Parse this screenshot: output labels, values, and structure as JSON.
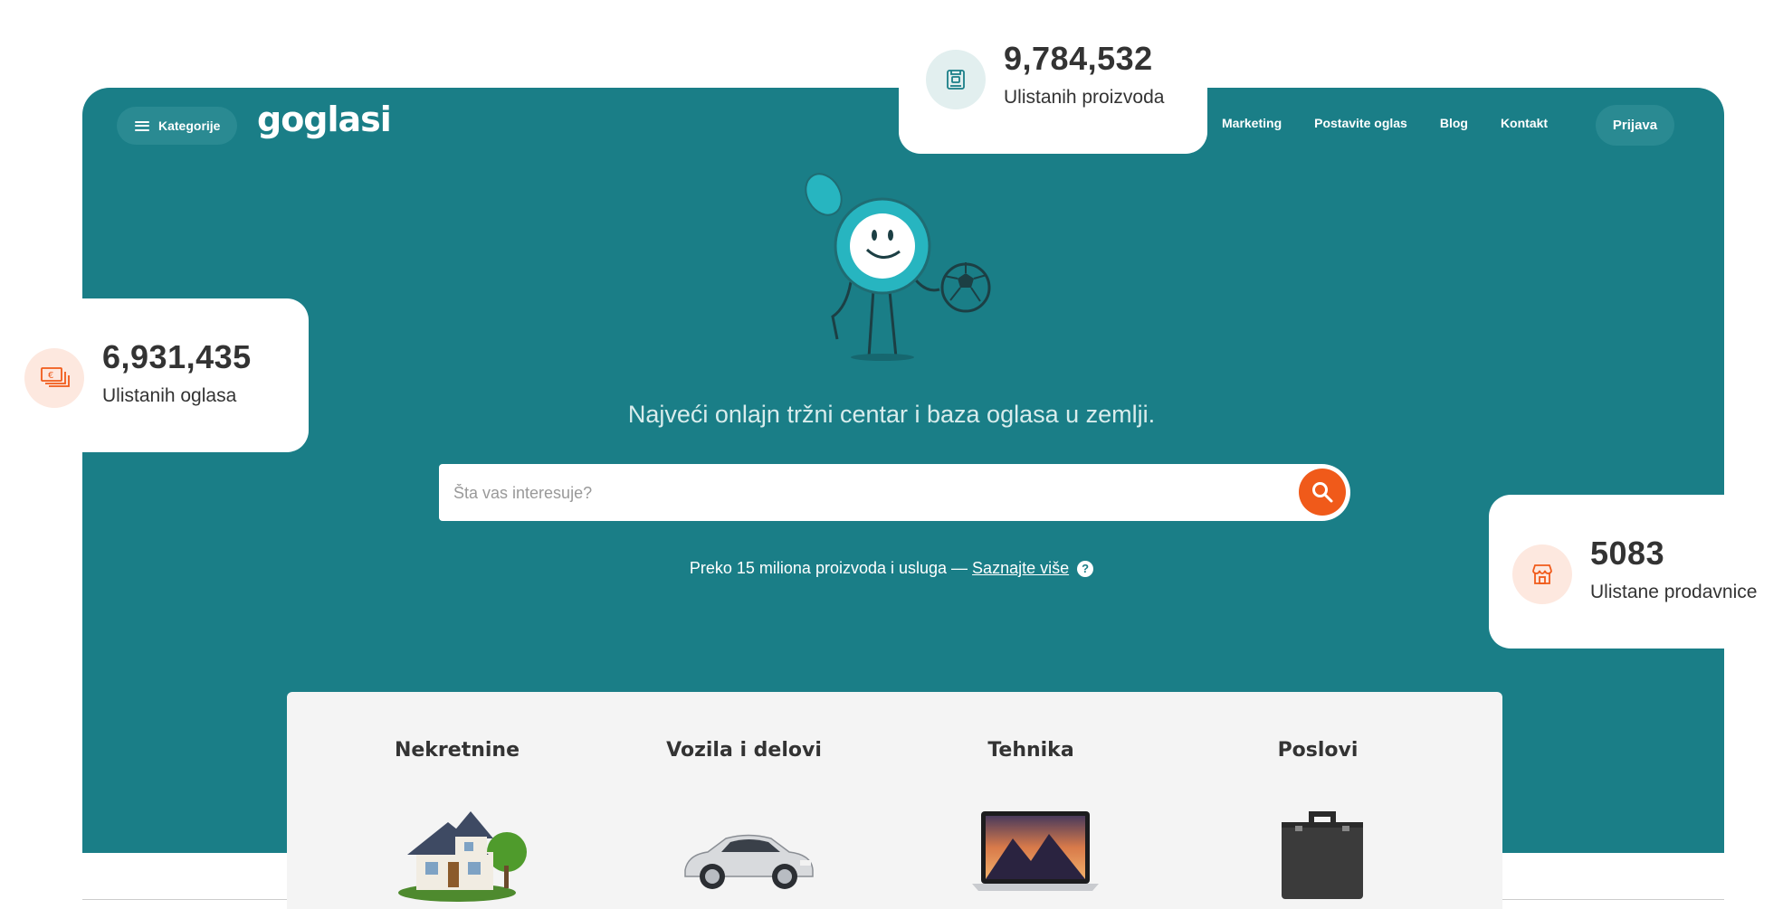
{
  "nav": {
    "categories_label": "Kategorije",
    "logo": "goglasi",
    "links": [
      "Marketing",
      "Postavite oglas",
      "Blog",
      "Kontakt"
    ],
    "login_label": "Prijava"
  },
  "stats": {
    "products": {
      "value": "9,784,532",
      "label": "Ulistanih proizvoda",
      "icon": "product-box-icon"
    },
    "ads": {
      "value": "6,931,435",
      "label": "Ulistanih oglasa",
      "icon": "money-stack-icon"
    },
    "stores": {
      "value": "5083",
      "label": "Ulistane prodavnice",
      "icon": "storefront-icon"
    }
  },
  "hero": {
    "tagline": "Najveći onlajn tržni centar i baza oglasa u zemlji.",
    "search_placeholder": "Šta vas interesuje?",
    "sub_text": "Preko 15 miliona proizvoda i usluga — ",
    "sub_link": "Saznajte više",
    "help": "?"
  },
  "categories": [
    {
      "label": "Nekretnine",
      "icon": "house-image"
    },
    {
      "label": "Vozila i delovi",
      "icon": "car-image"
    },
    {
      "label": "Tehnika",
      "icon": "laptop-image"
    },
    {
      "label": "Poslovi",
      "icon": "briefcase-image"
    }
  ],
  "colors": {
    "hero_bg": "#1a7e87",
    "accent": "#f05a1a",
    "light_teal": "#e2efef",
    "light_orange": "#fde8df"
  }
}
